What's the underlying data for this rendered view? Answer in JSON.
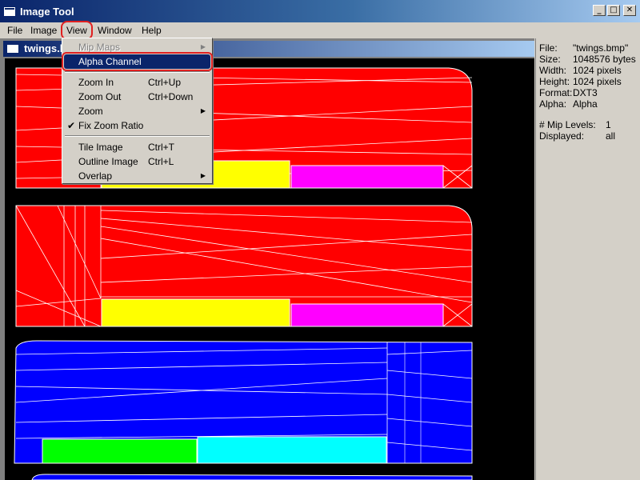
{
  "window": {
    "title": "Image Tool"
  },
  "menubar": [
    {
      "label": "File"
    },
    {
      "label": "Image"
    },
    {
      "label": "View"
    },
    {
      "label": "Window"
    },
    {
      "label": "Help"
    }
  ],
  "document": {
    "title": "twings.bmp"
  },
  "view_menu": [
    {
      "label": "Mip Maps",
      "shortcut": "",
      "disabled": true,
      "submenu": true,
      "checked": false
    },
    {
      "label": "Alpha Channel",
      "shortcut": "",
      "highlighted": true
    },
    {
      "label": "Zoom In",
      "shortcut": "Ctrl+Up"
    },
    {
      "label": "Zoom Out",
      "shortcut": "Ctrl+Down"
    },
    {
      "label": "Zoom",
      "shortcut": "",
      "submenu": true
    },
    {
      "label": "Fix Zoom Ratio",
      "shortcut": "",
      "checked": true
    },
    {
      "label": "Tile Image",
      "shortcut": "Ctrl+T"
    },
    {
      "label": "Outline Image",
      "shortcut": "Ctrl+L"
    },
    {
      "label": "Overlap",
      "shortcut": "",
      "submenu": true
    }
  ],
  "info": {
    "file_label": "File:",
    "file_value": "\"twings.bmp\"",
    "size_label": "Size:",
    "size_value": "1048576 bytes",
    "width_label": "Width:",
    "width_value": "1024 pixels",
    "height_label": "Height:",
    "height_value": "1024 pixels",
    "format_label": "Format:",
    "format_value": "DXT3",
    "alpha_label": "Alpha:",
    "alpha_value": "Alpha",
    "mip_label": "# Mip Levels:",
    "mip_value": "1",
    "displayed_label": "Displayed:",
    "displayed_value": "all"
  },
  "glyphs": {
    "submenu_arrow": "▶",
    "check": "✔",
    "minimize": "_",
    "maximize": "□",
    "close": "✕"
  },
  "colors": {
    "red": "#ff0000",
    "yellow": "#ffff00",
    "magenta": "#ff00ff",
    "blue": "#0000ff",
    "green": "#00ff00",
    "cyan": "#00ffff",
    "wire": "#ffffff"
  }
}
